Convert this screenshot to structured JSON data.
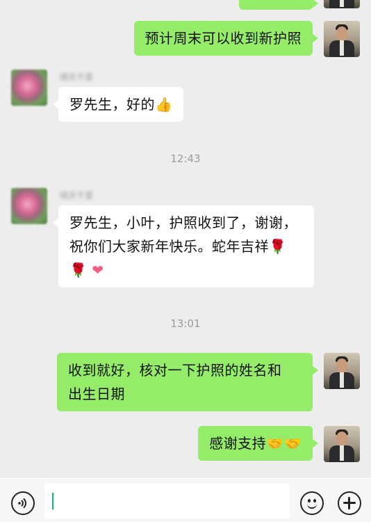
{
  "messages": [
    {
      "from": "me",
      "text": "预计周末可以收到新护照"
    },
    {
      "from": "other",
      "nickname": "晴天千里",
      "text": "罗先生，好的",
      "emoji": "👍"
    },
    {
      "timestamp": "12:43"
    },
    {
      "from": "other",
      "nickname": "晴天千里",
      "line1": "罗先生，小叶，护照收到了，谢谢，",
      "line2": "祝你们大家新年快乐。蛇年吉祥",
      "rose": "🌹",
      "heart": "❤"
    },
    {
      "timestamp": "13:01"
    },
    {
      "from": "me",
      "line1": "收到就好，核对一下护照的姓名和",
      "line2": "出生日期"
    },
    {
      "from": "me",
      "text": "感谢支持",
      "emoji": "🤝🤝"
    }
  ],
  "input_bar": {
    "voice_icon": "voice-icon",
    "emoji_icon": "emoji-icon",
    "plus_icon": "plus-icon",
    "input_value": ""
  },
  "colors": {
    "me_bubble": "#95ec69",
    "other_bubble": "#ffffff",
    "background": "#ededed",
    "caret": "#07c160"
  }
}
